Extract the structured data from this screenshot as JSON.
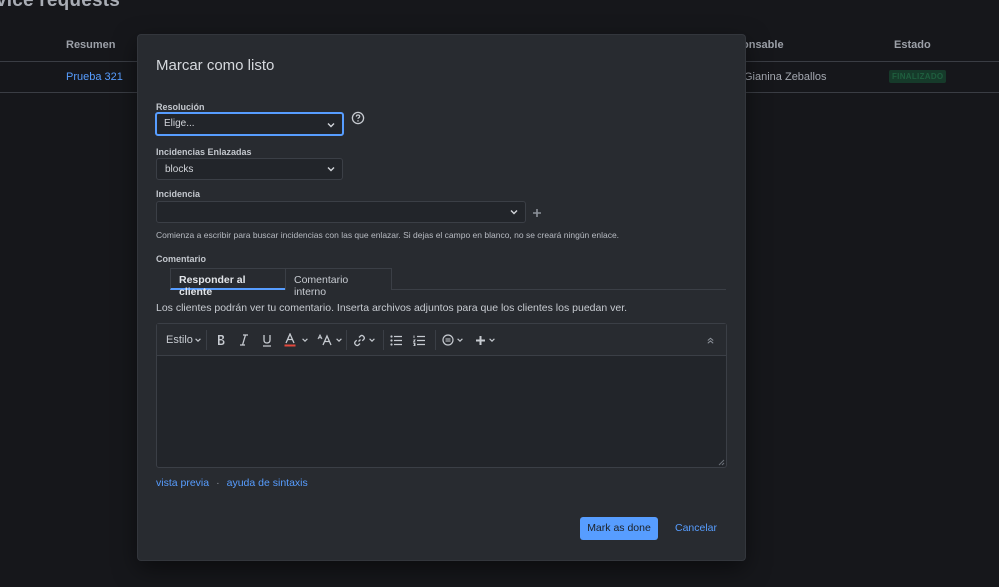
{
  "background": {
    "title": "vice requests",
    "columns": [
      "Resumen",
      "onsable",
      "Estado"
    ],
    "row": {
      "summary": "Prueba 321",
      "owner": "Gianina Zeballos",
      "status": "FINALIZADO"
    }
  },
  "modal": {
    "title": "Marcar como listo",
    "resolution": {
      "label": "Resolución",
      "value": "Elige..."
    },
    "linked_issues": {
      "label": "Incidencias Enlazadas",
      "value": "blocks"
    },
    "issue": {
      "label": "Incidencia",
      "value": ""
    },
    "hint": "Comienza a escribir para buscar incidencias con las que enlazar. Si dejas el campo en blanco, no se creará ningún enlace.",
    "comment": {
      "label": "Comentario",
      "tabs": [
        "Responder al cliente",
        "Comentario interno"
      ],
      "info": "Los clientes podrán ver tu comentario. Inserta archivos adjuntos para que los clientes los puedan ver.",
      "toolbar_style": "Estilo"
    },
    "links": {
      "preview": "vista previa",
      "syntax": "ayuda de sintaxis"
    },
    "buttons": {
      "done": "Mark as done",
      "cancel": "Cancelar"
    }
  },
  "colors": {
    "accent": "#579dff",
    "modal_bg": "#282b30",
    "page_bg": "#16171b",
    "text_color_red": "#e2483d"
  }
}
